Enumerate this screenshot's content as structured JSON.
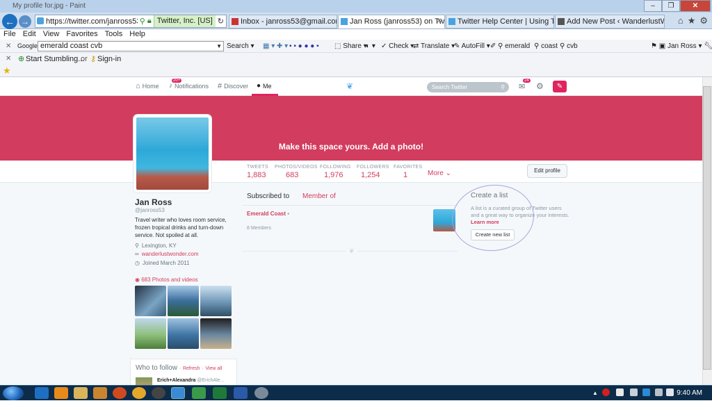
{
  "window": {
    "title": "My profile for.jpg - Paint"
  },
  "browser": {
    "url": "https://twitter.com/janross53/lists",
    "ssl_label": "Twitter, Inc. [US]",
    "tabs": [
      {
        "label": "Inbox - janross53@gmail.com ..."
      },
      {
        "label": "Jan Ross (janross53) on Twit..."
      },
      {
        "label": "Twitter Help Center | Using Twi..."
      },
      {
        "label": "Add New Post ‹ WanderlustW..."
      }
    ],
    "menu": [
      "File",
      "Edit",
      "View",
      "Favorites",
      "Tools",
      "Help"
    ]
  },
  "google_toolbar": {
    "brand": "Google",
    "query": "emerald coast cvb",
    "search_label": "Search",
    "share_label": "Share",
    "check_label": "Check",
    "translate_label": "Translate",
    "autofill_label": "AutoFill",
    "terms": [
      "emerald",
      "coast",
      "cvb"
    ],
    "user": "Jan Ross"
  },
  "stumble_toolbar": {
    "start_label": "Start Stumbling...",
    "or_label": "or",
    "signin_label": "Sign-in"
  },
  "twitter": {
    "nav": {
      "home": "Home",
      "notifications": "Notifications",
      "notifications_badge": "20+",
      "discover": "Discover",
      "me": "Me",
      "search_placeholder": "Search Twitter",
      "messages_badge": "24"
    },
    "banner_text": "Make this space yours. Add a photo!",
    "stats": [
      {
        "label": "TWEETS",
        "value": "1,883"
      },
      {
        "label": "PHOTOS/VIDEOS",
        "value": "683"
      },
      {
        "label": "FOLLOWING",
        "value": "1,976"
      },
      {
        "label": "FOLLOWERS",
        "value": "1,254"
      },
      {
        "label": "FAVORITES",
        "value": "1"
      }
    ],
    "more_label": "More",
    "edit_profile": "Edit profile",
    "profile": {
      "name": "Jan Ross",
      "handle": "@janross53",
      "bio": "Travel writer who loves room service, frozen tropical drinks and turn-down service. Not spoiled at all.",
      "location": "Lexington, KY",
      "website": "wanderlustwonder.com",
      "joined": "Joined March 2011",
      "photos_link": "683 Photos and videos"
    },
    "who_to_follow": {
      "title": "Who to follow",
      "refresh": "Refresh",
      "view_all": "View all",
      "sep": "·",
      "first_name": "Erich+Alexandra",
      "first_handle": "@ErichAle..."
    },
    "lists": {
      "tab_subscribed": "Subscribed to",
      "tab_member": "Member of",
      "items": [
        {
          "name": "Emerald Coast",
          "members": "8 Members"
        }
      ]
    },
    "create_list": {
      "title": "Create a list",
      "desc": "A list is a curated group of Twitter users and a great way to organize your interests.",
      "learn_more": "Learn more",
      "button": "Create new list"
    }
  },
  "taskbar": {
    "clock": "9:40 AM"
  },
  "colors": {
    "accent": "#d23c5e",
    "nav_blue": "#1f6fbf",
    "taskbar": "#0d2c4a"
  }
}
